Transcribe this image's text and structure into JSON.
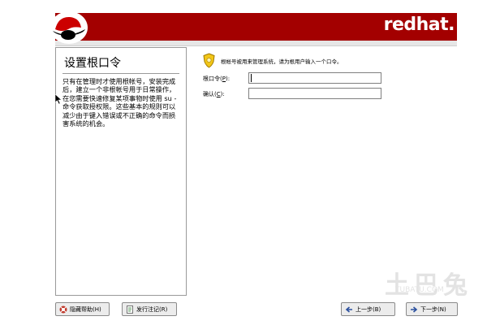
{
  "header": {
    "brand": "redhat."
  },
  "help": {
    "title": "设置根口令",
    "text": "只有在管理时才使用根帐号，安装完成后，建立一个非根帐号用于日常操作，在您需要快速修复某项事物时使用 su - 命令获取授权限。这些基本的规则可以减少由于键入错误或不正确的命令而损害系统的机会。"
  },
  "main": {
    "hint": "根帐号被用来管理系统，请为根用户输入一个口令。",
    "root_password_label": "根口令(",
    "root_password_key": "P",
    "root_password_suffix": "):",
    "confirm_label": "确认(",
    "confirm_key": "C",
    "confirm_suffix": "):",
    "root_password_value": "",
    "confirm_value": ""
  },
  "buttons": {
    "hide_help": "隐藏帮助(H)",
    "release_notes": "发行注记(R)",
    "back": "上一步(B)",
    "next": "下一步(N)"
  },
  "watermark": {
    "text": "土巴兔",
    "url": "TUBATU.COM"
  },
  "colors": {
    "banner": "#a30000"
  }
}
